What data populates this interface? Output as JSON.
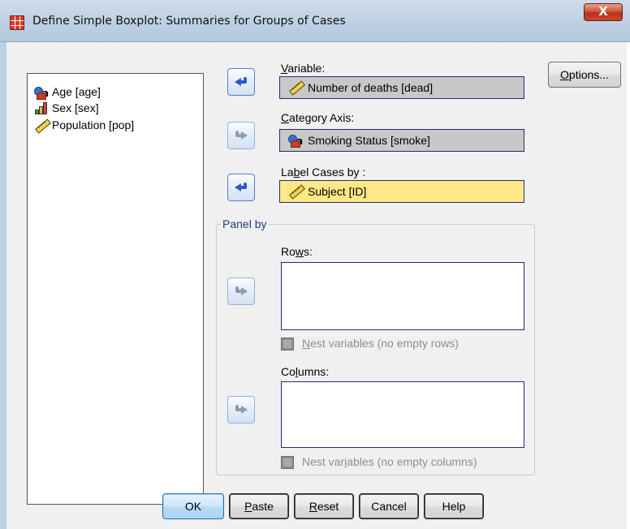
{
  "window": {
    "title": "Define Simple Boxplot: Summaries for Groups of Cases",
    "close_label": "X"
  },
  "source_list": {
    "items": [
      {
        "label": "Age [age]",
        "icon": "nominal-icon"
      },
      {
        "label": "Sex [sex]",
        "icon": "ordinal-icon"
      },
      {
        "label": "Population [pop]",
        "icon": "scale-icon"
      }
    ]
  },
  "icons": {
    "nominal_letter": "a"
  },
  "variable": {
    "label_pre": "",
    "label_u": "V",
    "label_post": "ariable:",
    "value": "Number of deaths [dead]"
  },
  "category_axis": {
    "label_pre": "",
    "label_u": "C",
    "label_post": "ategory Axis:",
    "value": "Smoking Status [smoke]"
  },
  "label_cases": {
    "label_pre": "La",
    "label_u": "b",
    "label_post": "el Cases by :",
    "value": "Subject [ID]"
  },
  "panel": {
    "title": "Panel by",
    "rows_label_pre": "Ro",
    "rows_label_u": "w",
    "rows_label_post": "s:",
    "nest_rows_pre": "",
    "nest_rows_u": "N",
    "nest_rows_post": "est variables (no empty rows)",
    "columns_label_pre": "Co",
    "columns_label_u": "l",
    "columns_label_post": "umns:",
    "nest_cols_pre": "Nest var",
    "nest_cols_u": "i",
    "nest_cols_post": "ables (no empty columns)"
  },
  "options_button": {
    "pre": "",
    "u": "O",
    "post": "ptions..."
  },
  "buttons": {
    "ok": "OK",
    "paste": {
      "pre": "",
      "u": "P",
      "post": "aste"
    },
    "reset": {
      "pre": "",
      "u": "R",
      "post": "eset"
    },
    "cancel": "Cancel",
    "help": "Help"
  },
  "colors": {
    "selected_field": "#fde786",
    "filled_field": "#c8c8c8",
    "arrow_active": "#2c59c8",
    "arrow_disabled": "#8f9ca9",
    "group_title": "#1e3d7a"
  }
}
